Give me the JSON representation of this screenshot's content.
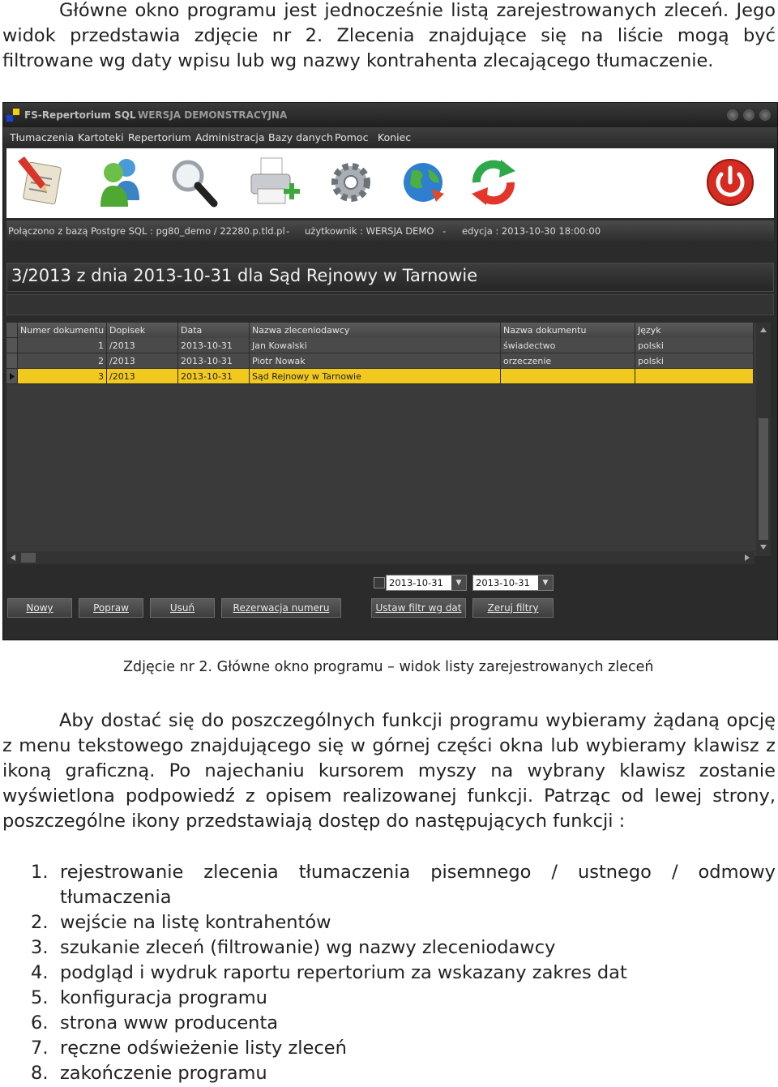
{
  "intro_lines": [
    "Główne okno programu jest jednocześnie listą zarejestrowanych zleceń. Jego",
    "widok przedstawia zdjęcie nr 2. Zlecenia znajdujące się na liście mogą być",
    "filtrowane wg daty wpisu lub wg nazwy kontrahenta zlecającego tłumaczenie."
  ],
  "window": {
    "app_title": "FS-Repertorium SQL",
    "demo_label": "WERSJA DEMONSTRACYJNA",
    "menu": [
      "Tłumaczenia",
      "Kartoteki",
      "Repertorium",
      "Administracja",
      "Bazy danych",
      "Pomoc",
      "Koniec"
    ],
    "toolbar_icons": [
      "pen-document-icon",
      "user-icon",
      "magnifier-icon",
      "printer-icon",
      "gear-icon",
      "globe-icon",
      "refresh-icon",
      "power-icon"
    ],
    "status": {
      "connection": "Połączono z bazą Postgre SQL : pg80_demo / 22280.p.tld.pl",
      "sep1": "-",
      "user": "użytkownik : WERSJA DEMO",
      "sep2": "-",
      "edition": "edycja : 2013-10-30 18:00:00"
    },
    "heading": "3/2013 z dnia 2013-10-31 dla Sąd Rejnowy w Tarnowie",
    "columns": [
      "Numer dokumentu",
      "Dopisek",
      "Data",
      "Nazwa zleceniodawcy",
      "Nazwa dokumentu",
      "Język"
    ],
    "rows": [
      {
        "num": "1",
        "dopisek": "/2013",
        "data": "2013-10-31",
        "zleceniodawca": "Jan Kowalski",
        "dokument": "świadectwo",
        "jezyk": "polski"
      },
      {
        "num": "2",
        "dopisek": "/2013",
        "data": "2013-10-31",
        "zleceniodawca": "Piotr Nowak",
        "dokument": "orzeczenie",
        "jezyk": "polski"
      },
      {
        "num": "3",
        "dopisek": "/2013",
        "data": "2013-10-31",
        "zleceniodawca": "Sąd Rejnowy w Tarnowie",
        "dokument": "",
        "jezyk": ""
      }
    ],
    "selected_row": 3,
    "date_from": "2013-10-31",
    "date_to": "2013-10-31",
    "buttons": {
      "new": "Nowy",
      "edit": "Popraw",
      "delete": "Usuń",
      "reserve": "Rezerwacja numeru",
      "date_filter": "Ustaw filtr wg dat",
      "reset_filters": "Zeruj filtry"
    },
    "colors": {
      "selected_row": "#f2c91e",
      "background": "#2b2b2b"
    }
  },
  "caption": "Zdjęcie nr 2. Główne okno programu – widok listy zarejestrowanych zleceń",
  "body_lines": [
    "Aby dostać się do poszczególnych funkcji programu wybieramy żądaną opcję",
    "z menu tekstowego znajdującego się w górnej części okna lub wybieramy klawisz z",
    "ikoną graficzną. Po najechaniu kursorem myszy na wybrany klawisz zostanie",
    "wyświetlona podpowiedź z opisem realizowanej funkcji. Patrząc od lewej strony,",
    "poszczególne ikony przedstawiają dostęp do następujących funkcji :"
  ],
  "list": [
    {
      "n": "1.",
      "line1": "rejestrowanie zlecenia tłumaczenia pisemnego / ustnego / odmowy",
      "line2": "tłumaczenia"
    },
    {
      "n": "2.",
      "line1": "wejście na listę kontrahentów"
    },
    {
      "n": "3.",
      "line1": "szukanie zleceń (filtrowanie) wg nazwy zleceniodawcy"
    },
    {
      "n": "4.",
      "line1": "podgląd i wydruk raportu repertorium za wskazany zakres dat"
    },
    {
      "n": "5.",
      "line1": "konfiguracja programu"
    },
    {
      "n": "6.",
      "line1": "strona www producenta"
    },
    {
      "n": "7.",
      "line1": "ręczne odświeżenie listy zleceń"
    },
    {
      "n": "8.",
      "line1": "zakończenie programu"
    }
  ]
}
